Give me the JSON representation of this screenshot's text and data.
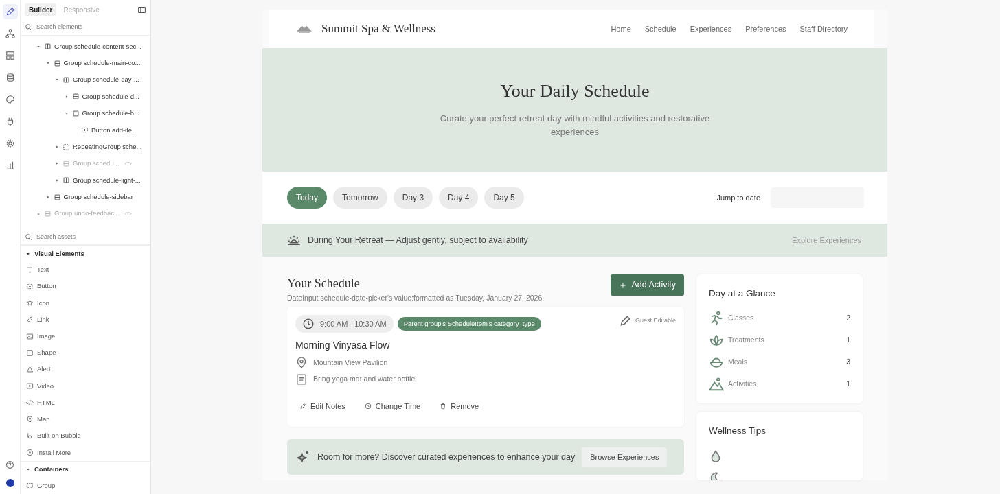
{
  "rail": {
    "items": [
      {
        "kind": "pencil",
        "selected": true
      },
      {
        "kind": "tree",
        "selected": false
      },
      {
        "kind": "layout",
        "selected": false
      },
      {
        "kind": "database",
        "selected": false
      },
      {
        "kind": "palette",
        "selected": false
      },
      {
        "kind": "plug",
        "selected": false
      },
      {
        "kind": "gear",
        "selected": false
      },
      {
        "kind": "chart",
        "selected": false
      }
    ],
    "bottom": [
      {
        "kind": "help"
      },
      {
        "kind": "avatar"
      }
    ]
  },
  "panel": {
    "tabs": [
      {
        "label": "Builder",
        "selected": true
      },
      {
        "label": "Responsive",
        "selected": false
      }
    ],
    "search": {
      "placeholder": "Search elements"
    },
    "tree": [
      {
        "label": "Group schedule-content-sec...",
        "kind": "column",
        "expanded": true,
        "hidden": false,
        "children": [
          {
            "label": "Group schedule-main-co...",
            "kind": "row",
            "expanded": true,
            "hidden": false,
            "children": [
              {
                "label": "Group schedule-day-...",
                "kind": "column",
                "expanded": true,
                "hidden": false,
                "children": [
                  {
                    "label": "Group schedule-d...",
                    "kind": "row",
                    "expanded": false,
                    "hidden": false
                  },
                  {
                    "label": "Group schedule-h...",
                    "kind": "column",
                    "expanded": true,
                    "hidden": false,
                    "children": [
                      {
                        "label": "Button add-ite...",
                        "kind": "button",
                        "hidden": false
                      }
                    ]
                  }
                ]
              },
              {
                "label": "RepeatingGroup sche...",
                "kind": "repeating",
                "expanded": false,
                "hidden": false
              },
              {
                "label": "Group schedu...",
                "kind": "row",
                "expanded": false,
                "hidden": true
              },
              {
                "label": "Group schedule-light-...",
                "kind": "column",
                "expanded": false,
                "hidden": false
              }
            ]
          },
          {
            "label": "Group schedule-sidebar",
            "kind": "row",
            "expanded": false,
            "hidden": false
          }
        ]
      },
      {
        "label": "Group undo-feedbac...",
        "kind": "row",
        "expanded": false,
        "hidden": true
      }
    ],
    "asset_search": {
      "placeholder": "Search assets"
    },
    "sections": [
      {
        "title": "Visual Elements",
        "expanded": true,
        "items": [
          {
            "label": "Text",
            "kind": "text"
          },
          {
            "label": "Button",
            "kind": "button"
          },
          {
            "label": "Icon",
            "kind": "star"
          },
          {
            "label": "Link",
            "kind": "link"
          },
          {
            "label": "Image",
            "kind": "image"
          },
          {
            "label": "Shape",
            "kind": "shape"
          },
          {
            "label": "Alert",
            "kind": "alert"
          },
          {
            "label": "Video",
            "kind": "video"
          },
          {
            "label": "HTML",
            "kind": "code"
          },
          {
            "label": "Map",
            "kind": "pin"
          },
          {
            "label": "Built on Bubble",
            "kind": "bubble"
          },
          {
            "label": "Install More",
            "kind": "plus"
          }
        ]
      },
      {
        "title": "Containers",
        "expanded": true,
        "items": [
          {
            "label": "Group",
            "kind": "group"
          }
        ]
      }
    ]
  },
  "site": {
    "brand": "Summit Spa & Wellness",
    "nav": [
      "Home",
      "Schedule",
      "Experiences",
      "Preferences",
      "Staff Directory"
    ],
    "hero": {
      "title": "Your Daily Schedule",
      "subtitle": "Curate your perfect retreat day with mindful activities and restorative experiences"
    },
    "days": [
      {
        "label": "Today",
        "selected": true
      },
      {
        "label": "Tomorrow",
        "selected": false
      },
      {
        "label": "Day 3",
        "selected": false
      },
      {
        "label": "Day 4",
        "selected": false
      },
      {
        "label": "Day 5",
        "selected": false
      }
    ],
    "jump_label": "Jump to date",
    "banner": {
      "text": "During Your Retreat — Adjust gently, subject to availability",
      "link": "Explore Experiences"
    },
    "schedule": {
      "title": "Your Schedule",
      "date": "DateInput schedule-date-picker's value:formatted as Tuesday, January 27, 2026",
      "add_button": "Add Activity",
      "items": [
        {
          "time": "9:00 AM - 10:30 AM",
          "category": "Parent group's ScheduleItem's category_type",
          "editable": "Guest Editable",
          "name": "Morning Vinyasa Flow",
          "location": "Mountain View Pavilion",
          "note": "Bring yoga mat and water bottle",
          "actions": [
            {
              "label": "Edit Notes",
              "kind": "pencil"
            },
            {
              "label": "Change Time",
              "kind": "clock"
            },
            {
              "label": "Remove",
              "kind": "trash"
            }
          ]
        }
      ],
      "promo": {
        "text": "Room for more? Discover curated experiences to enhance your day",
        "button": "Browse Experiences"
      }
    },
    "glance": {
      "title": "Day at a Glance",
      "rows": [
        {
          "label": "Classes",
          "count": "2",
          "kind": "run"
        },
        {
          "label": "Treatments",
          "count": "1",
          "kind": "lotus"
        },
        {
          "label": "Meals",
          "count": "3",
          "kind": "bowl"
        },
        {
          "label": "Activities",
          "count": "1",
          "kind": "mountain"
        }
      ]
    },
    "tips": {
      "title": "Wellness Tips",
      "items": [
        {
          "kind": "drop"
        },
        {
          "kind": "moon"
        }
      ]
    }
  }
}
